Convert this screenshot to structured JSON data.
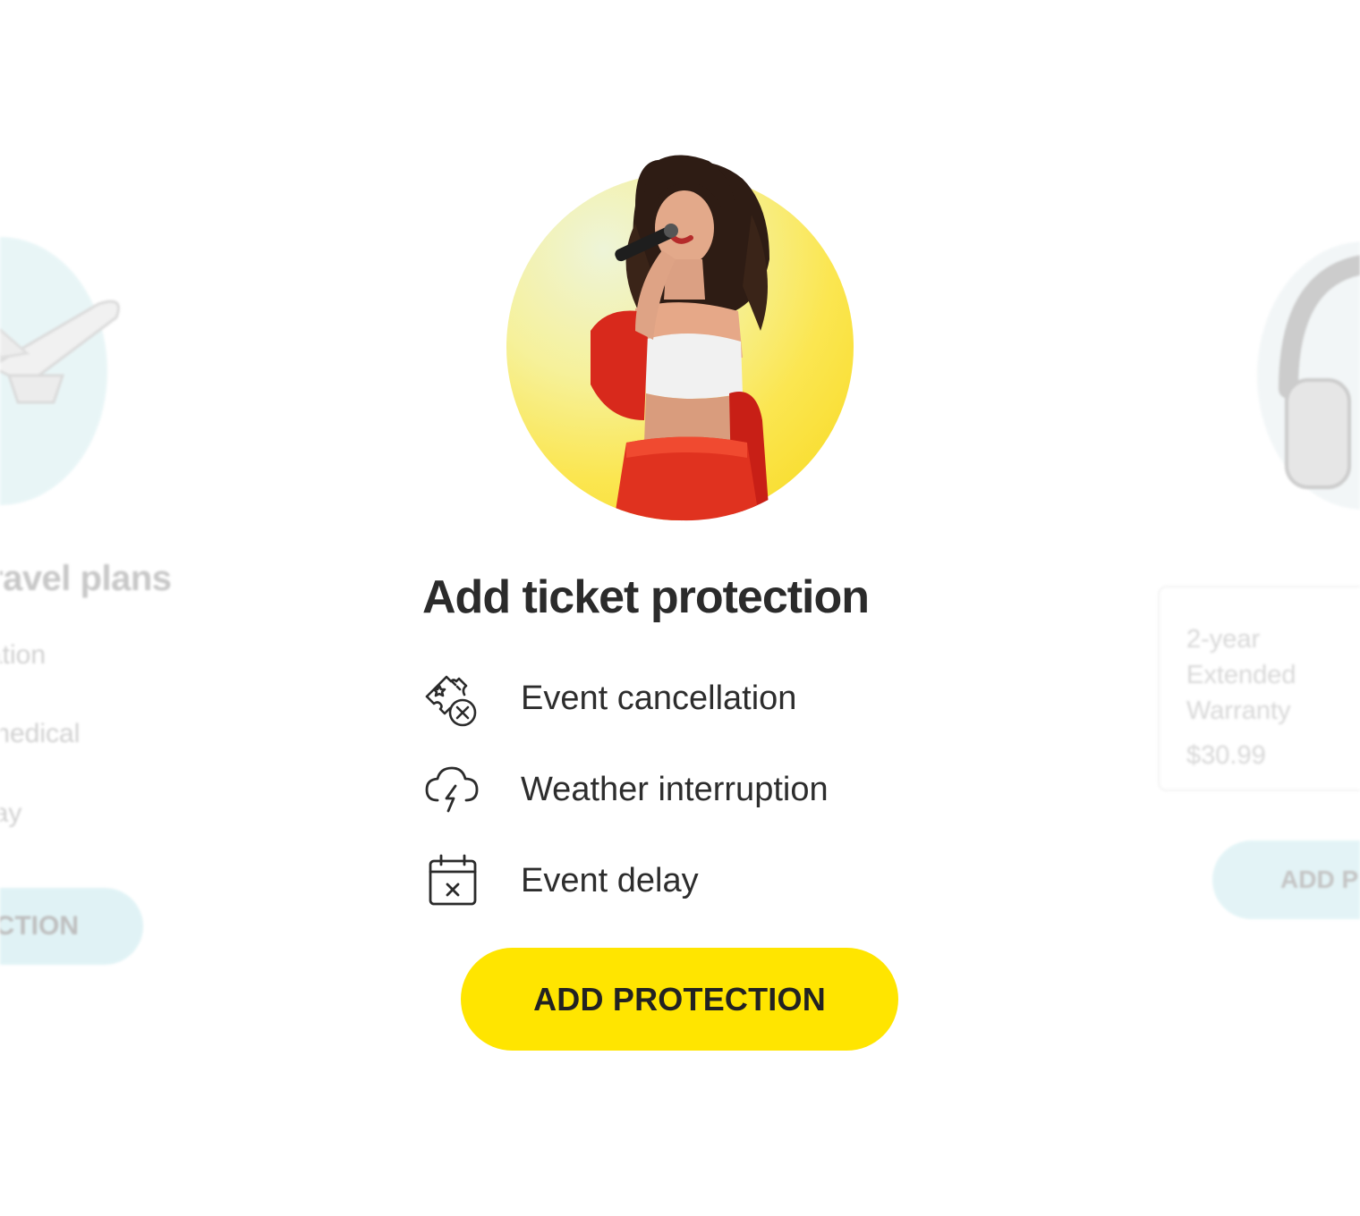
{
  "left_card": {
    "title": "ravel plans",
    "features": [
      "ation",
      "medical",
      "lay"
    ],
    "button_label": "CTION",
    "image_icon": "airplane-icon"
  },
  "main_card": {
    "title": "Add ticket protection",
    "features": [
      {
        "label": "Event cancellation",
        "icon": "ticket-cancel-icon"
      },
      {
        "label": "Weather interruption",
        "icon": "storm-cloud-icon"
      },
      {
        "label": "Event delay",
        "icon": "calendar-cancel-icon"
      }
    ],
    "button_label": "ADD PROTECTION",
    "accent_color": "#ffe500"
  },
  "right_card": {
    "plan_name": "2-year Extended Warranty",
    "price": "$30.99",
    "button_label": "ADD P",
    "image_icon": "headphones-icon"
  }
}
